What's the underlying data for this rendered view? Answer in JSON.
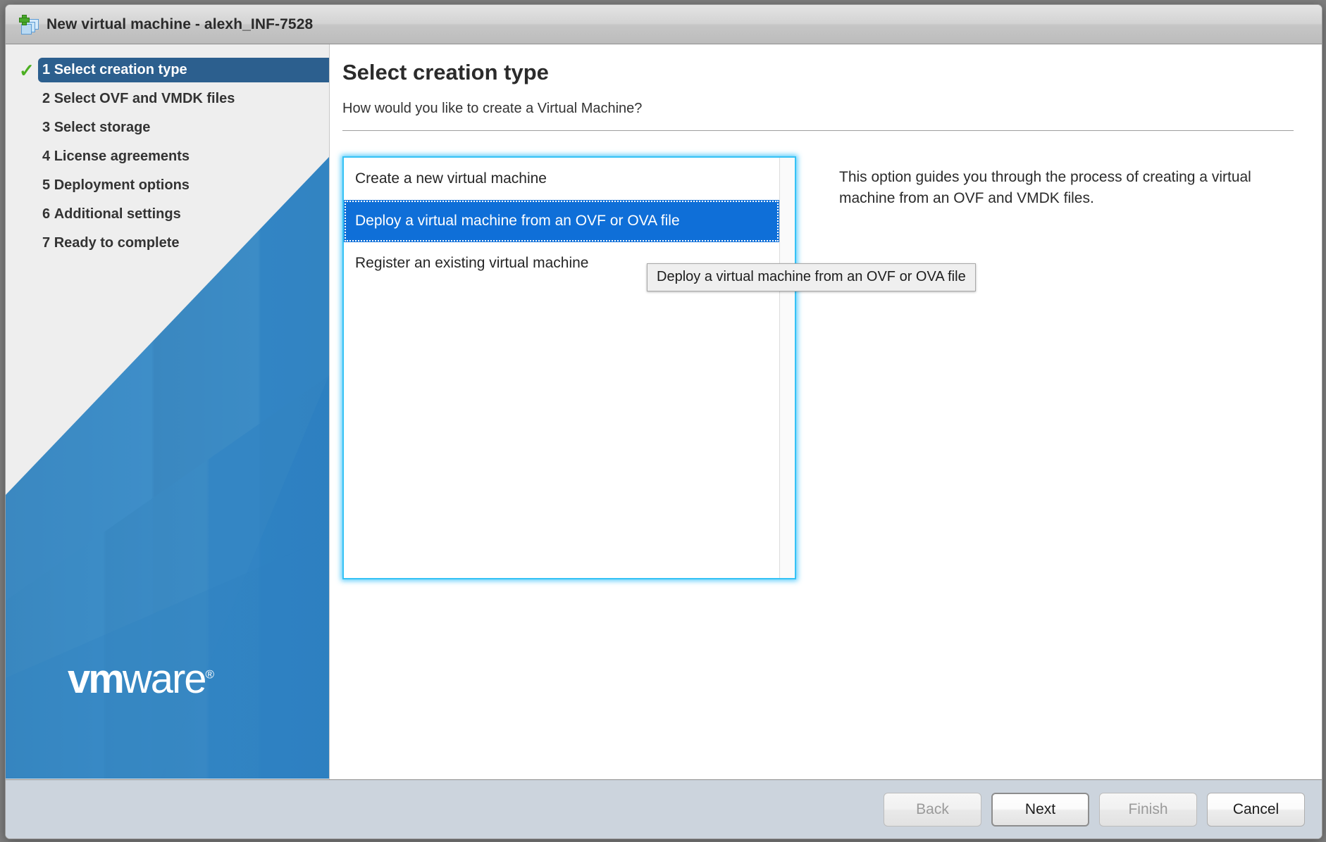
{
  "window": {
    "title": "New virtual machine - alexh_INF-7528",
    "icon": "new-virtual-machine-icon"
  },
  "sidebar": {
    "logo": {
      "bold": "vm",
      "light": "ware",
      "registered": "®"
    },
    "steps": [
      {
        "number": "1",
        "label": "Select creation type",
        "active": true,
        "completed": true
      },
      {
        "number": "2",
        "label": "Select OVF and VMDK files",
        "active": false,
        "completed": false
      },
      {
        "number": "3",
        "label": "Select storage",
        "active": false,
        "completed": false
      },
      {
        "number": "4",
        "label": "License agreements",
        "active": false,
        "completed": false
      },
      {
        "number": "5",
        "label": "Deployment options",
        "active": false,
        "completed": false
      },
      {
        "number": "6",
        "label": "Additional settings",
        "active": false,
        "completed": false
      },
      {
        "number": "7",
        "label": "Ready to complete",
        "active": false,
        "completed": false
      }
    ]
  },
  "main": {
    "heading": "Select creation type",
    "subheading": "How would you like to create a Virtual Machine?",
    "options": [
      {
        "label": "Create a new virtual machine",
        "selected": false
      },
      {
        "label": "Deploy a virtual machine from an OVF or OVA file",
        "selected": true
      },
      {
        "label": "Register an existing virtual machine",
        "selected": false
      }
    ],
    "tooltip": "Deploy a virtual machine from an OVF or OVA file",
    "description": "This option guides you through the process of creating a virtual machine from an OVF and VMDK files."
  },
  "footer": {
    "buttons": [
      {
        "label": "Back",
        "enabled": false,
        "default": false
      },
      {
        "label": "Next",
        "enabled": true,
        "default": true
      },
      {
        "label": "Finish",
        "enabled": false,
        "default": false
      },
      {
        "label": "Cancel",
        "enabled": true,
        "default": false
      }
    ]
  },
  "colors": {
    "accent_blue": "#2c5f8e",
    "selection_blue": "#0f6fd8",
    "focus_cyan": "#35c2f5",
    "check_green": "#4caf22",
    "footer_bg": "#ccd4dd"
  }
}
